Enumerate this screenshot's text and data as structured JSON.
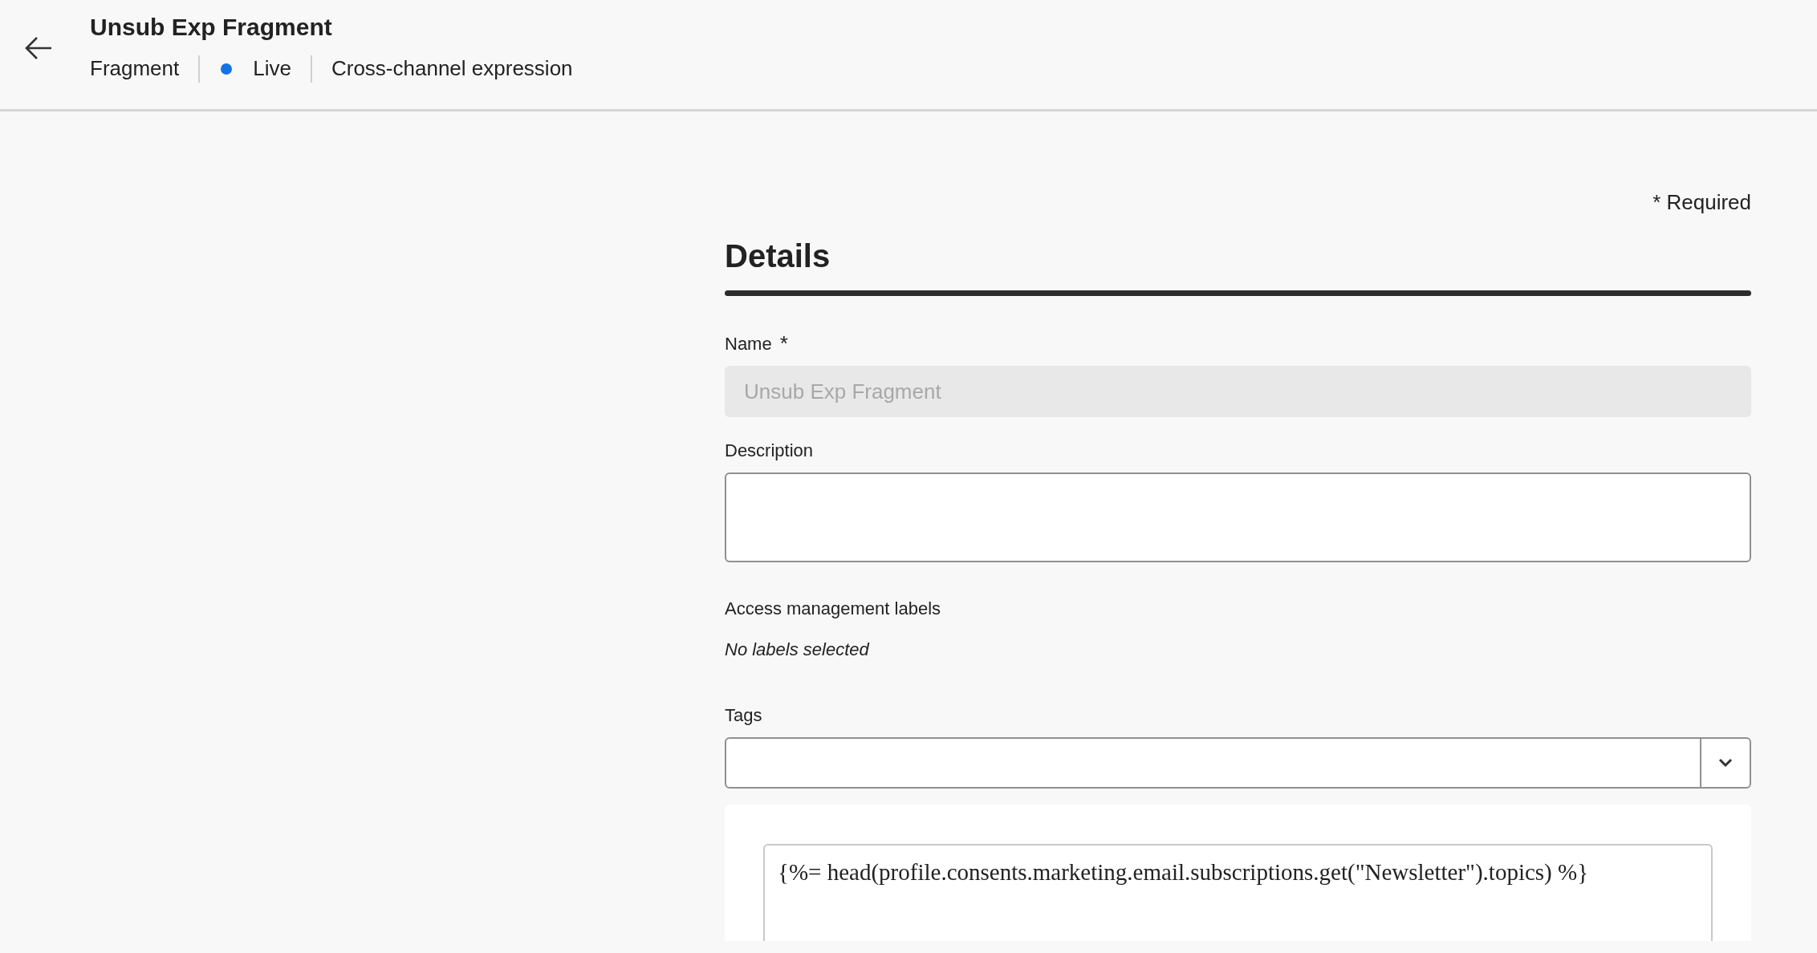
{
  "header": {
    "title": "Unsub Exp Fragment",
    "meta": [
      {
        "kind": "text",
        "label": "Fragment"
      },
      {
        "kind": "status",
        "label": "Live",
        "color": "#1473e6"
      },
      {
        "kind": "text",
        "label": "Cross-channel expression"
      }
    ]
  },
  "required_note": "* Required",
  "section_title": "Details",
  "fields": [
    {
      "kind": "input",
      "label": "Name",
      "required_mark": "*",
      "value": "Unsub Exp Fragment",
      "disabled": true
    },
    {
      "kind": "textarea",
      "label": "Description"
    },
    {
      "kind": "note",
      "label": "Access management labels",
      "value": "No labels selected"
    },
    {
      "kind": "select",
      "label": "Tags"
    }
  ],
  "expression_editor": {
    "code": "{%= head(profile.consents.marketing.email.subscriptions.get(\"Newsletter\").topics) %}"
  }
}
